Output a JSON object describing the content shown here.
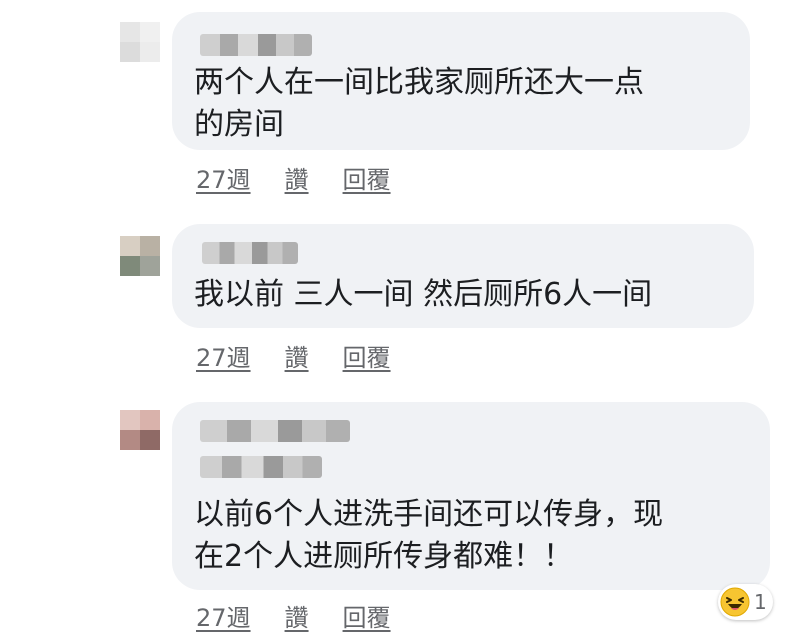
{
  "comments": [
    {
      "text_lines": [
        "两个人在一间比我家厕所还大一点",
        "的房间"
      ],
      "actions": {
        "time": "27週",
        "like": "讚",
        "reply": "回覆"
      }
    },
    {
      "text_lines": [
        "我以前 三人一间 然后厕所6人一间"
      ],
      "actions": {
        "time": "27週",
        "like": "讚",
        "reply": "回覆"
      }
    },
    {
      "text_lines": [
        "以前6个人进洗手间还可以传身，现",
        "在2个人进厕所传身都难！！"
      ],
      "actions": {
        "time": "27週",
        "like": "讚",
        "reply": "回覆"
      },
      "reaction": {
        "icon": "laughing-emoji-icon",
        "count": "1"
      }
    }
  ]
}
